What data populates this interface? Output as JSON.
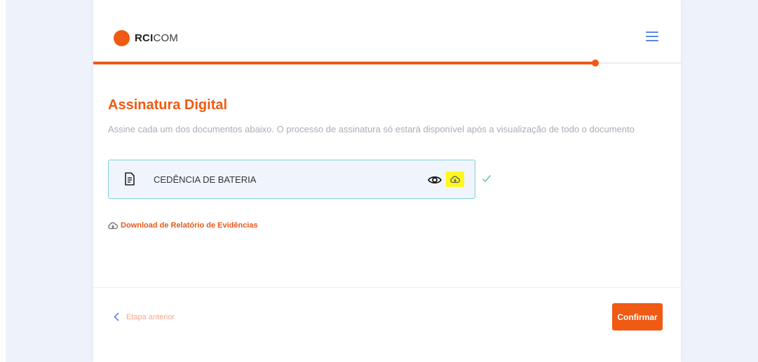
{
  "app": {
    "logo_bold": "RCI",
    "logo_light": "COM"
  },
  "progress": {
    "fraction": 0.855
  },
  "page": {
    "title": "Assinatura Digital",
    "subtitle": "Assine cada um dos documentos abaixo. O processo de assinatura só estará disponível após a visualização de todo o documento"
  },
  "documents": [
    {
      "name": "CEDÊNCIA DE BATERIA",
      "status": "signed"
    }
  ],
  "report_link": "Download de Relatório de Evidências",
  "footer": {
    "back_label": "Etapa anterior",
    "confirm_label": "Confirmar"
  },
  "colors": {
    "brand": "#f05a12",
    "accent_blue": "#5b86e5",
    "doc_border": "#7fd2d4",
    "check": "#4fc9b0",
    "highlight": "#fff71f"
  },
  "icons": [
    "document-icon",
    "eye-icon",
    "cloud-download-icon",
    "check-icon",
    "menu-icon",
    "chevron-left-icon"
  ]
}
